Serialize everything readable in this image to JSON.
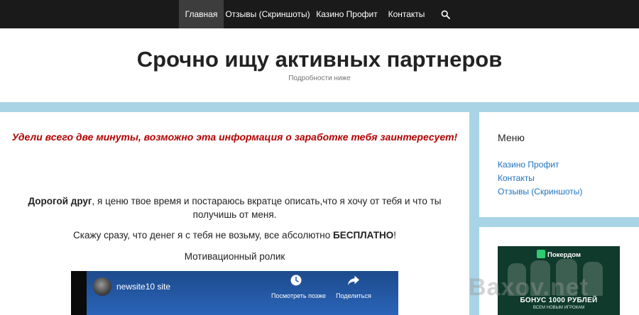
{
  "nav": {
    "items": [
      {
        "label": "Главная",
        "active": true
      },
      {
        "label": "Отзывы (Скриншоты)",
        "active": false
      },
      {
        "label": "Казино Профит",
        "active": false
      },
      {
        "label": "Контакты",
        "active": false
      }
    ],
    "search_icon": "search-icon"
  },
  "header": {
    "title": "Срочно ищу активных партнеров",
    "tagline": "Подробности ниже"
  },
  "content": {
    "headline": "Удели всего две минуты, возможно эта информация о заработке тебя заинтересует!",
    "intro_bold": "Дорогой друг",
    "intro_text": ", я ценю твое время и постараюсь вкратце описать,что я хочу от тебя и что ты получишь от меня.",
    "free_text": "Скажу сразу, что денег я с тебя не возьму, все абсолютно ",
    "free_bold": "БЕСПЛАТНО",
    "free_end": "!",
    "video_caption": "Мотивационный ролик"
  },
  "video": {
    "channel": "newsite10 site",
    "watch_later": "Посмотреть позже",
    "share": "Поделиться",
    "bg_color": "#2a64b8"
  },
  "sidebar": {
    "menu_title": "Меню",
    "links": [
      "Казино Профит",
      "Контакты",
      "Отзывы (Скриншоты)"
    ],
    "link_color": "#1e73be"
  },
  "banner": {
    "logo": "Покердом",
    "bonus": "БОНУС 1000 РУБЛЕЙ",
    "subtitle": "ВСЕМ НОВЫМ ИГРОКАМ"
  },
  "watermark": "Baxov.net",
  "colors": {
    "nav_bg": "#1a1a1a",
    "page_bg": "#a9d4e6",
    "headline": "#b30000"
  }
}
